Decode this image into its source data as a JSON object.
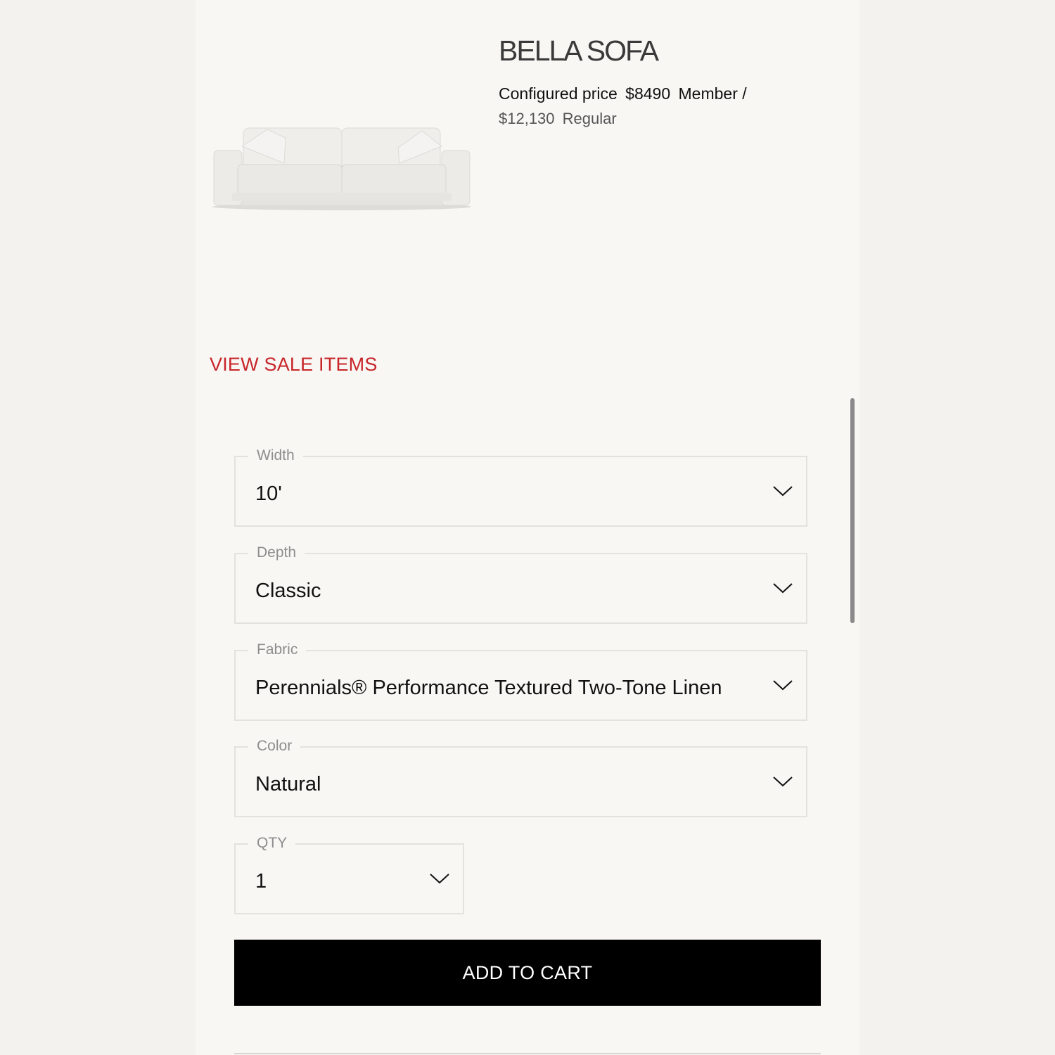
{
  "product": {
    "title": "BELLA SOFA",
    "price_label": "Configured price",
    "member_price": "$8490",
    "member_label": "Member /",
    "regular_price": "$12,130",
    "regular_label": "Regular",
    "image_icon": "sofa-image"
  },
  "sale_link": "VIEW SALE ITEMS",
  "options": {
    "width": {
      "label": "Width",
      "value": "10'"
    },
    "depth": {
      "label": "Depth",
      "value": "Classic"
    },
    "fabric": {
      "label": "Fabric",
      "value": "Perennials® Performance Textured Two-Tone Linen"
    },
    "color": {
      "label": "Color",
      "value": "Natural"
    },
    "qty": {
      "label": "QTY",
      "value": "1"
    }
  },
  "cart": {
    "add_label": "ADD TO CART"
  },
  "colors": {
    "sale_red": "#c8262a",
    "button_black": "#000000",
    "background": "#f8f7f4"
  }
}
